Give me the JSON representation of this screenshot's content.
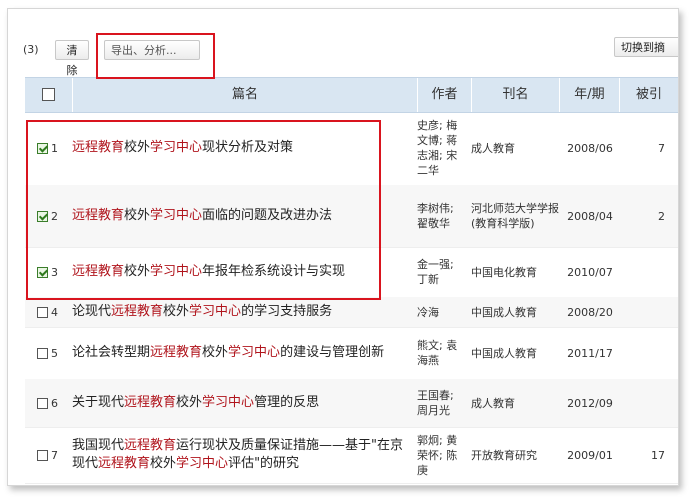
{
  "toolbar": {
    "selected_count": "(3)",
    "clear_label": "清除",
    "export_label": "导出、分析...",
    "switch_label": "切换到摘"
  },
  "table": {
    "headers": {
      "title": "篇名",
      "author": "作者",
      "journal": "刊名",
      "issue": "年/期",
      "cited": "被引"
    },
    "rows": [
      {
        "num": "1",
        "checked": true,
        "title_parts": [
          [
            "远程教育",
            "red"
          ],
          [
            "校外",
            "plain"
          ],
          [
            "学习中心",
            "red"
          ],
          [
            "现状分析及对策",
            "plain"
          ]
        ],
        "authors": "史彦; 梅文博; 蒋志湘; 宋二华",
        "journal": "成人教育",
        "issue": "2008/06",
        "cited": "7"
      },
      {
        "num": "2",
        "checked": true,
        "title_parts": [
          [
            "远程教育",
            "red"
          ],
          [
            "校外",
            "plain"
          ],
          [
            "学习中心",
            "red"
          ],
          [
            "面临的问题及改进办法",
            "plain"
          ]
        ],
        "authors": "李树伟; 翟敬华",
        "journal": "河北师范大学学报(教育科学版)",
        "issue": "2008/04",
        "cited": "2"
      },
      {
        "num": "3",
        "checked": true,
        "title_parts": [
          [
            "远程教育",
            "red"
          ],
          [
            "校外",
            "plain"
          ],
          [
            "学习中心",
            "red"
          ],
          [
            "年报年检系统设计与实现",
            "plain"
          ]
        ],
        "authors": "金一强; 丁新",
        "journal": "中国电化教育",
        "issue": "2010/07",
        "cited": ""
      },
      {
        "num": "4",
        "checked": false,
        "title_parts": [
          [
            "论现代",
            "plain"
          ],
          [
            "远程教育",
            "red"
          ],
          [
            "校外",
            "plain"
          ],
          [
            "学习中心",
            "red"
          ],
          [
            "的学习支持服务",
            "plain"
          ]
        ],
        "authors": "冷海",
        "journal": "中国成人教育",
        "issue": "2008/20",
        "cited": ""
      },
      {
        "num": "5",
        "checked": false,
        "title_parts": [
          [
            "论社会转型期",
            "plain"
          ],
          [
            "远程教育",
            "red"
          ],
          [
            "校外",
            "plain"
          ],
          [
            "学习中心",
            "red"
          ],
          [
            "的建设与管理创新",
            "plain"
          ]
        ],
        "authors": "熊文; 袁海燕",
        "journal": "中国成人教育",
        "issue": "2011/17",
        "cited": ""
      },
      {
        "num": "6",
        "checked": false,
        "title_parts": [
          [
            "关于现代",
            "plain"
          ],
          [
            "远程教育",
            "red"
          ],
          [
            "校外",
            "plain"
          ],
          [
            "学习中心",
            "red"
          ],
          [
            "管理的反思",
            "plain"
          ]
        ],
        "authors": "王国春; 周月光",
        "journal": "成人教育",
        "issue": "2012/09",
        "cited": ""
      },
      {
        "num": "7",
        "checked": false,
        "title_parts": [
          [
            "我国现代",
            "plain"
          ],
          [
            "远程教育",
            "red"
          ],
          [
            "运行现状及质量保证措施——基于\"在京现代",
            "plain"
          ],
          [
            "远程教育",
            "red"
          ],
          [
            "校外",
            "plain"
          ],
          [
            "学习中心",
            "red"
          ],
          [
            "评估\"的研究",
            "plain"
          ]
        ],
        "authors": "郭炯; 黄荣怀; 陈庚",
        "journal": "开放教育研究",
        "issue": "2009/01",
        "cited": "17"
      }
    ]
  },
  "colors": {
    "highlight": "#b0141c",
    "header_bg": "#d9e6f2",
    "annotation_box": "#d9141e"
  }
}
